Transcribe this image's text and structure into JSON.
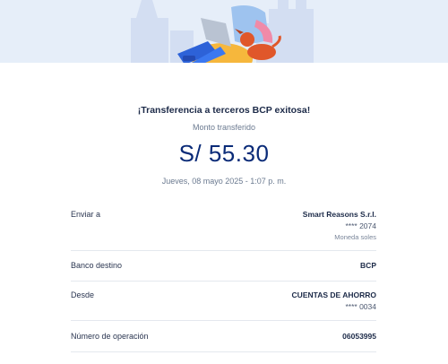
{
  "colors": {
    "hero_bg": "#e6eef9",
    "amount": "#0a2b78",
    "accent": "#f0a23c"
  },
  "illustration": {
    "icon": "person-with-laptop-and-dog-illustration"
  },
  "header": {
    "title": "¡Transferencia a terceros BCP exitosa!",
    "amount_label": "Monto transferido",
    "amount": "S/ 55.30",
    "datetime": "Jueves, 08 mayo 2025 - 1:07 p. m."
  },
  "details": {
    "send_to": {
      "label": "Enviar a",
      "name": "Smart Reasons S.r.l.",
      "account": "**** 2074",
      "currency": "Moneda soles"
    },
    "bank": {
      "label": "Banco destino",
      "value": "BCP"
    },
    "from": {
      "label": "Desde",
      "account_type": "CUENTAS DE AHORRO",
      "account": "**** 0034"
    },
    "operation": {
      "label": "Número de operación",
      "value": "06053995"
    }
  }
}
